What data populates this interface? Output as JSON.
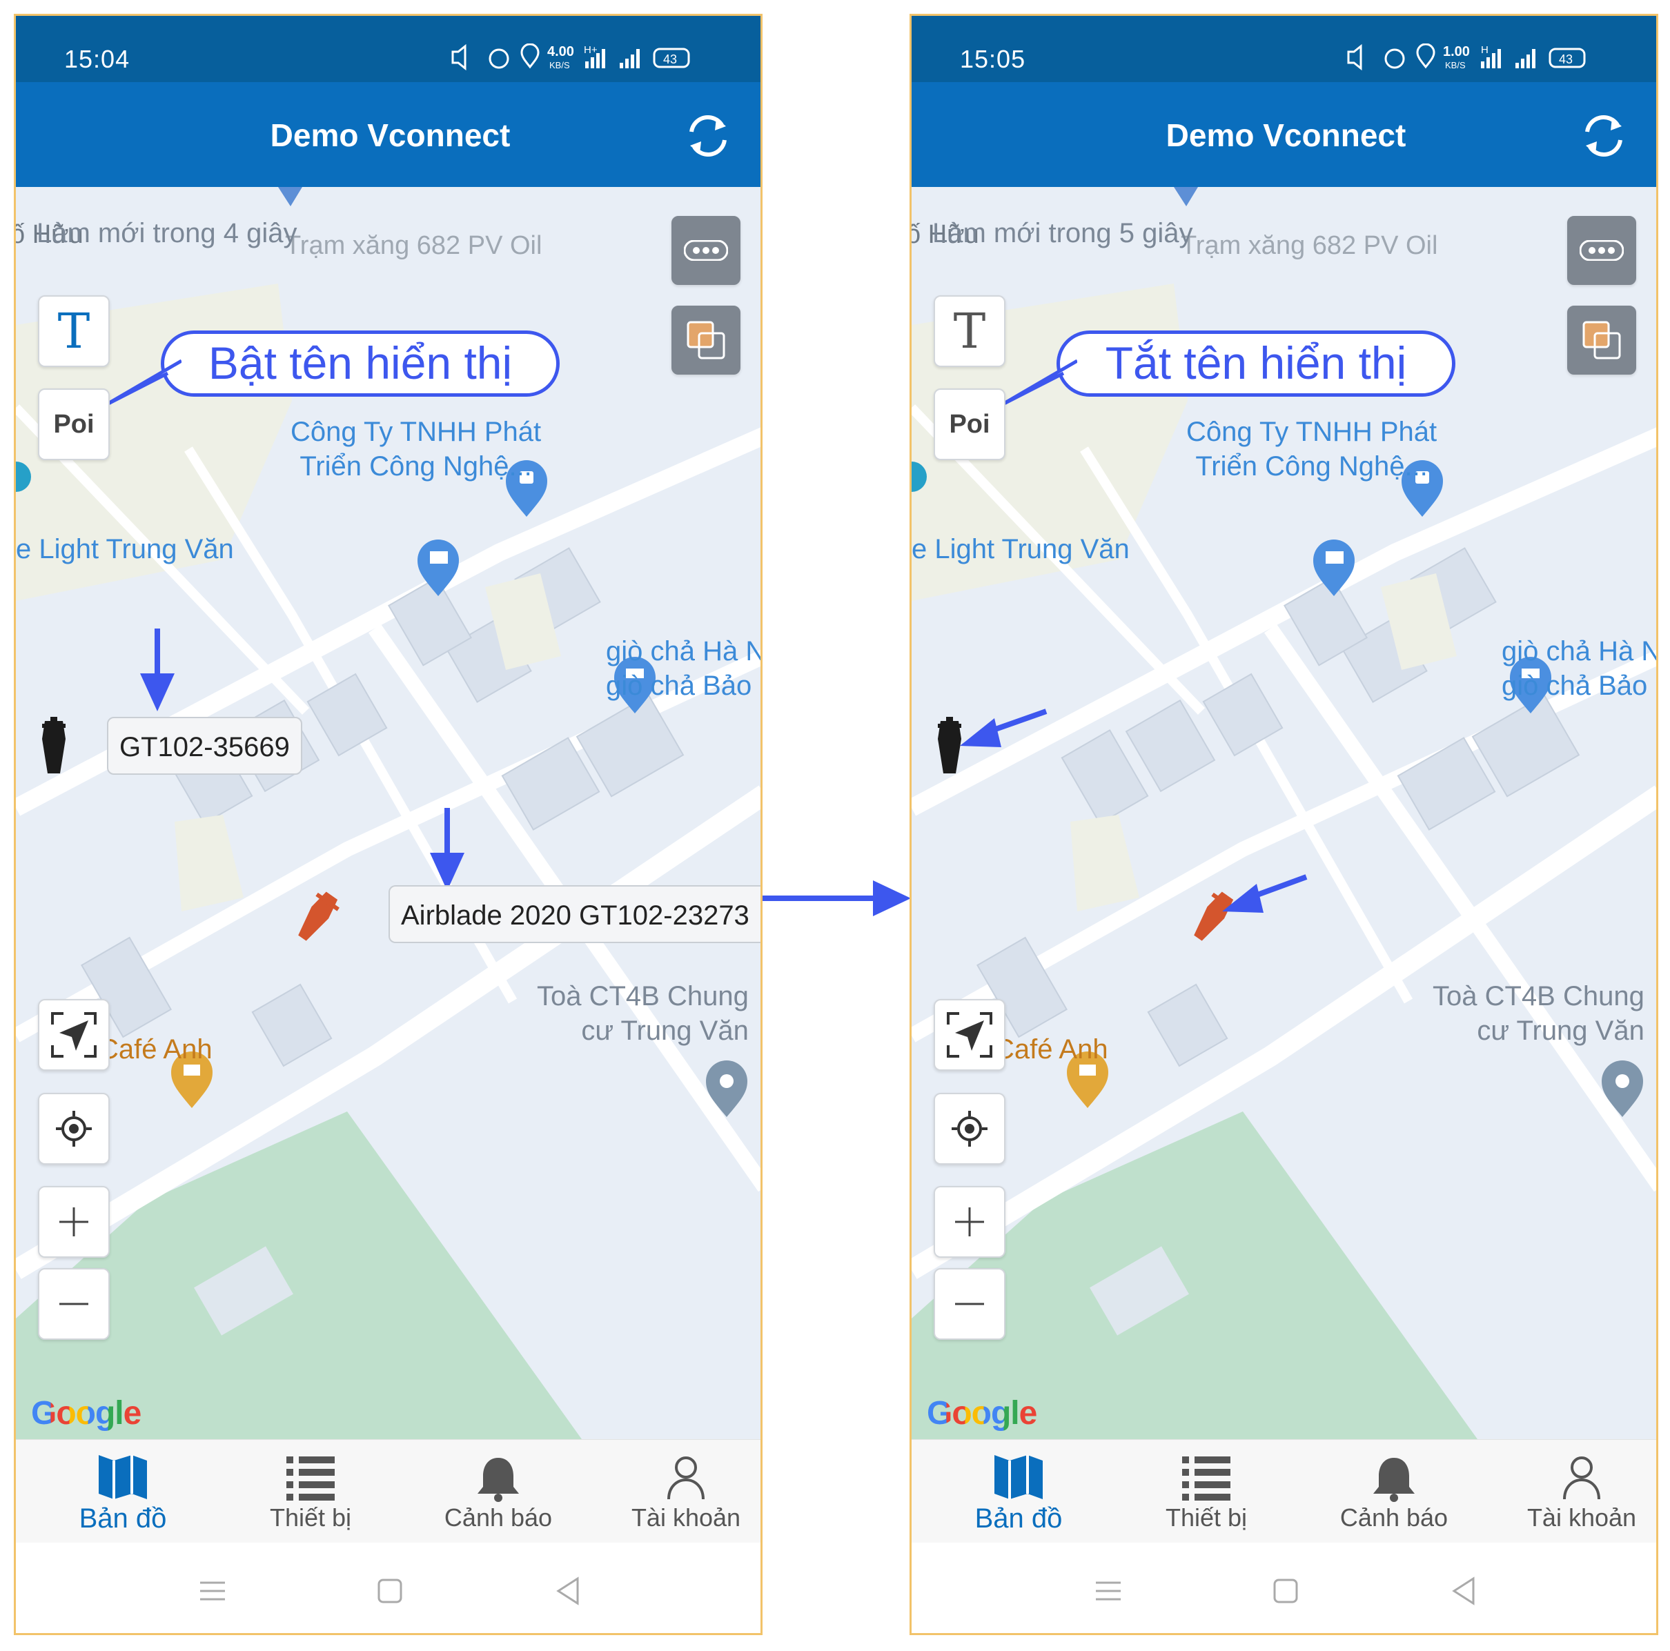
{
  "screens": [
    {
      "status": {
        "time": "15:04",
        "net_speed": "4.00",
        "net_unit": "KB/S",
        "net_type": "H+",
        "battery": "43"
      },
      "app_title": "Demo Vconnect",
      "map": {
        "refresh_notice": "Làm mới trong 4 giây",
        "bg_label_top": "ố Hữu",
        "bg_label_top2": "Trạm xăng 682 PV Oil",
        "label_company": [
          "Công Ty TNHH Phát",
          "Triển Công Nghệ..."
        ],
        "label_light": "e Light Trung Văn",
        "label_giocha": [
          "giò chả Hà N",
          "giò chả Bảo"
        ],
        "label_toa": [
          "Toà CT4B Chung",
          "cư Trung Văn"
        ],
        "label_cafe": "Café Anh",
        "text_button": "T",
        "poi_button": "Poi",
        "google": "Google"
      },
      "vehicle_labels": [
        "GT102-35669",
        "Airblade 2020 GT102-23273"
      ],
      "callout": "Bật tên hiển thị"
    },
    {
      "status": {
        "time": "15:05",
        "net_speed": "1.00",
        "net_unit": "KB/S",
        "net_type": "H",
        "battery": "43"
      },
      "app_title": "Demo Vconnect",
      "map": {
        "refresh_notice": "Làm mới trong 5 giây",
        "bg_label_top": "ố Hữu",
        "bg_label_top2": "Trạm xăng 682 PV Oil",
        "label_company": [
          "Công Ty TNHH Phát",
          "Triển Công Nghệ..."
        ],
        "label_light": "e Light Trung Văn",
        "label_giocha": [
          "giò chả Hà N",
          "giò chả Bảo"
        ],
        "label_toa": [
          "Toà CT4B Chung",
          "cư Trung Văn"
        ],
        "label_cafe": "Café Anh",
        "text_button": "T",
        "poi_button": "Poi",
        "google": "Google"
      },
      "callout": "Tắt tên hiển thị"
    }
  ],
  "bottom_nav": [
    {
      "label": "Bản đồ",
      "icon": "map-icon",
      "active": true
    },
    {
      "label": "Thiết bị",
      "icon": "list-icon",
      "active": false
    },
    {
      "label": "Cảnh báo",
      "icon": "bell-icon",
      "active": false
    },
    {
      "label": "Tài khoản",
      "icon": "user-icon",
      "active": false
    }
  ],
  "colors": {
    "status_bar": "#075f9c",
    "app_bar": "#0a6ebd",
    "annotation": "#3d57ee",
    "park": "#bfe0cc"
  }
}
